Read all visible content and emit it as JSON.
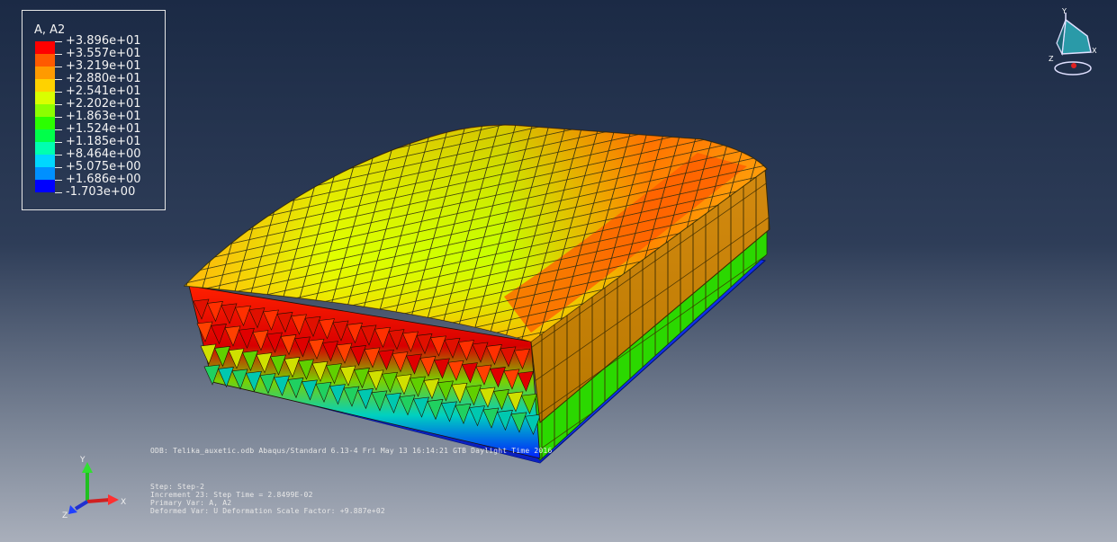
{
  "legend": {
    "title": "A, A2",
    "labels": [
      "+3.896e+01",
      "+3.557e+01",
      "+3.219e+01",
      "+2.880e+01",
      "+2.541e+01",
      "+2.202e+01",
      "+1.863e+01",
      "+1.524e+01",
      "+1.185e+01",
      "+8.464e+00",
      "+5.075e+00",
      "+1.686e+00",
      "-1.703e+00"
    ],
    "colors": [
      "#ff0000",
      "#ff5a00",
      "#ff9a00",
      "#ffd200",
      "#d9ff00",
      "#8cff00",
      "#2bff00",
      "#00ff4a",
      "#00ffb0",
      "#00d7ff",
      "#0090ff",
      "#0040ff",
      "#0000ff"
    ]
  },
  "info": {
    "odb_line": "ODB: Telika_auxetic.odb    Abaqus/Standard 6.13-4    Fri May 13 16:14:21 GTB Daylight Time 2016",
    "step": "Step: Step-2",
    "increment": "Increment     23: Step Time =    2.8499E-02",
    "primary_var": "Primary Var: A, A2",
    "deformed_var": "Deformed Var: U   Deformation Scale Factor: +9.887e+02"
  },
  "triad": {
    "y": "Y",
    "z": "Z",
    "x": "X"
  },
  "view_cube": {
    "y": "Y",
    "z": "Z",
    "x": "X"
  }
}
